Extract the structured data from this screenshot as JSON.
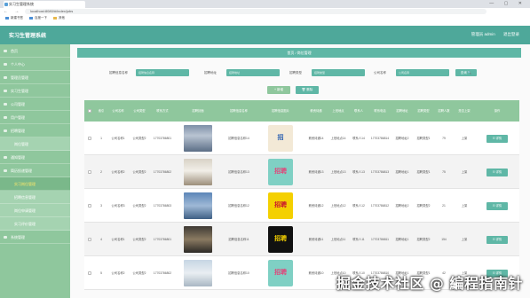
{
  "browser": {
    "tab_title": "实习生管理系统",
    "url": "localhost:8080/#/index/jobs",
    "bookmarks": [
      "新建书签",
      "百度一下",
      "其他"
    ],
    "window_controls": "— ▢ ✕",
    "nav_buttons": "← → ↻"
  },
  "app": {
    "title": "实习生管理系统",
    "user_label": "管理员 admin",
    "logout_label": "退出登录"
  },
  "sidebar": {
    "items": [
      {
        "label": "首页"
      },
      {
        "label": "个人中心"
      },
      {
        "label": "管理员管理"
      },
      {
        "label": "实习生管理"
      },
      {
        "label": "公司管理"
      },
      {
        "label": "用户管理"
      },
      {
        "label": "招聘管理"
      },
      {
        "label": "岗位管理"
      },
      {
        "label": "通知管理"
      },
      {
        "label": "简历投递管理"
      },
      {
        "label": "实习岗位管理"
      },
      {
        "label": "招聘信息管理"
      },
      {
        "label": "岗位申请管理"
      },
      {
        "label": "实习评价管理"
      },
      {
        "label": "系统管理"
      }
    ]
  },
  "breadcrumb": "首页 / 岗位管理",
  "filters": [
    {
      "label": "招聘信息名称",
      "placeholder": "招聘信息名称"
    },
    {
      "label": "招聘地址",
      "placeholder": "招聘地址"
    },
    {
      "label": "招聘类型",
      "placeholder": "招聘类型"
    },
    {
      "label": "公司名称",
      "placeholder": "公司名称"
    }
  ],
  "search_label": "查询 🔍",
  "add_label": "+ 新增",
  "delete_label": "🗑 删除",
  "columns": [
    "",
    "索引",
    "公司名称",
    "公司类型",
    "联系方式",
    "招聘封面",
    "招聘信息名称",
    "招聘信息图片",
    "薪资待遇",
    "上班地点",
    "联系人",
    "联系电话",
    "招聘地址",
    "招聘类型",
    "招聘人数",
    "是否上架",
    "操作"
  ],
  "rows": [
    {
      "index": "1",
      "company": "公司名称1",
      "ctype": "公司类型2",
      "phone": "17703786801",
      "title": "招聘信息名称14",
      "poster": "招",
      "salary": "薪资待遇14",
      "workplace": "上班地点14",
      "contact": "联系人14",
      "contact_phone": "17703786814",
      "address": "招聘地址2",
      "jtype": "招聘类型1",
      "count": "79",
      "status": "上架"
    },
    {
      "index": "2",
      "company": "公司名称2",
      "ctype": "公司类型2",
      "phone": "17703786802",
      "title": "招聘信息名称13",
      "poster": "招聘",
      "salary": "薪资待遇13",
      "workplace": "上班地点13",
      "contact": "联系人13",
      "contact_phone": "17703786813",
      "address": "招聘地址1",
      "jtype": "招聘类型1",
      "count": "75",
      "status": "上架"
    },
    {
      "index": "3",
      "company": "公司名称3",
      "ctype": "公司类型2",
      "phone": "17703786803",
      "title": "招聘信息名称12",
      "poster": "招聘",
      "salary": "薪资待遇12",
      "workplace": "上班地点12",
      "contact": "联系人12",
      "contact_phone": "17703786812",
      "address": "招聘地址2",
      "jtype": "招聘类型2",
      "count": "21",
      "status": "上架"
    },
    {
      "index": "4",
      "company": "公司名称1",
      "ctype": "公司类型2",
      "phone": "17703786801",
      "title": "招聘信息名称11",
      "poster": "招聘",
      "salary": "薪资待遇11",
      "workplace": "上班地点11",
      "contact": "联系人11",
      "contact_phone": "17703786811",
      "address": "招聘地址1",
      "jtype": "招聘类型2",
      "count": "154",
      "status": "上架"
    },
    {
      "index": "5",
      "company": "公司名称2",
      "ctype": "公司类型2",
      "phone": "17703786802",
      "title": "招聘信息名称10",
      "poster": "招聘",
      "salary": "薪资待遇10",
      "workplace": "上班地点10",
      "contact": "联系人10",
      "contact_phone": "17703786810",
      "address": "招聘地址1",
      "jtype": "招聘类型1",
      "count": "42",
      "status": "上架"
    }
  ],
  "detail_label": "☷ 详情",
  "watermark": "掘金技术社区 @ 編程指南针",
  "colors": {
    "header": "#4ea89a",
    "sidebar": "#8fc79d",
    "accent": "#5fb7a6"
  }
}
